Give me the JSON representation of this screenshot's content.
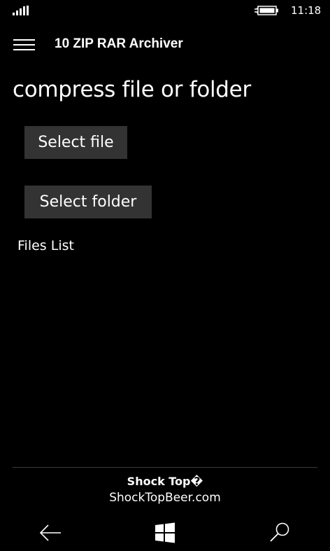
{
  "status_bar": {
    "time": "11:18",
    "signal_icon": "signal-strength-icon",
    "battery_icon": "battery-charging-icon"
  },
  "header": {
    "menu_icon": "hamburger-menu-icon",
    "app_title": "10 ZIP RAR Archiver"
  },
  "main": {
    "page_title": "compress file or folder",
    "select_file_label": "Select file",
    "select_folder_label": "Select folder",
    "files_list_label": "Files List"
  },
  "ad": {
    "title": "Shock Top�",
    "url": "ShockTopBeer.com"
  },
  "nav_bar": {
    "back_icon": "back-arrow-icon",
    "home_icon": "windows-start-icon",
    "search_icon": "search-icon"
  },
  "colors": {
    "background": "#000000",
    "button_background": "#333333",
    "text": "#ffffff"
  }
}
